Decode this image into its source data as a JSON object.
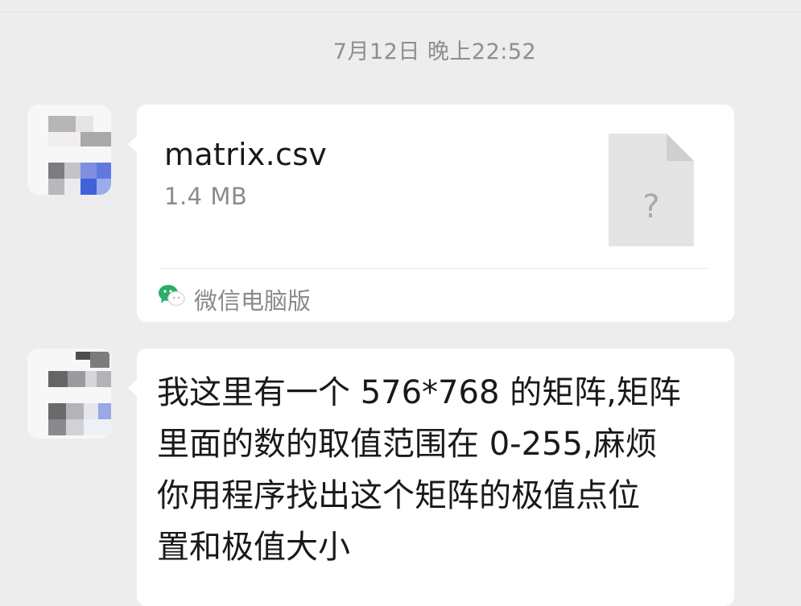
{
  "chat": {
    "timestamp": "7月12日 晚上22:52",
    "messages": [
      {
        "type": "file",
        "file_name": "matrix.csv",
        "file_size": "1.4 MB",
        "file_icon": "unknown-file-icon",
        "file_icon_glyph": "?",
        "source_icon": "wechat-icon",
        "source_label": "微信电脑版"
      },
      {
        "type": "text",
        "text": "我这里有一个 576*768 的矩阵,矩阵\n里面的数的取值范围在 0-255,麻烦\n你用程序找出这个矩阵的极值点位\n置和极值大小"
      }
    ]
  },
  "colors": {
    "background": "#ededed",
    "bubble": "#ffffff",
    "wechat_green": "#2aae67"
  }
}
